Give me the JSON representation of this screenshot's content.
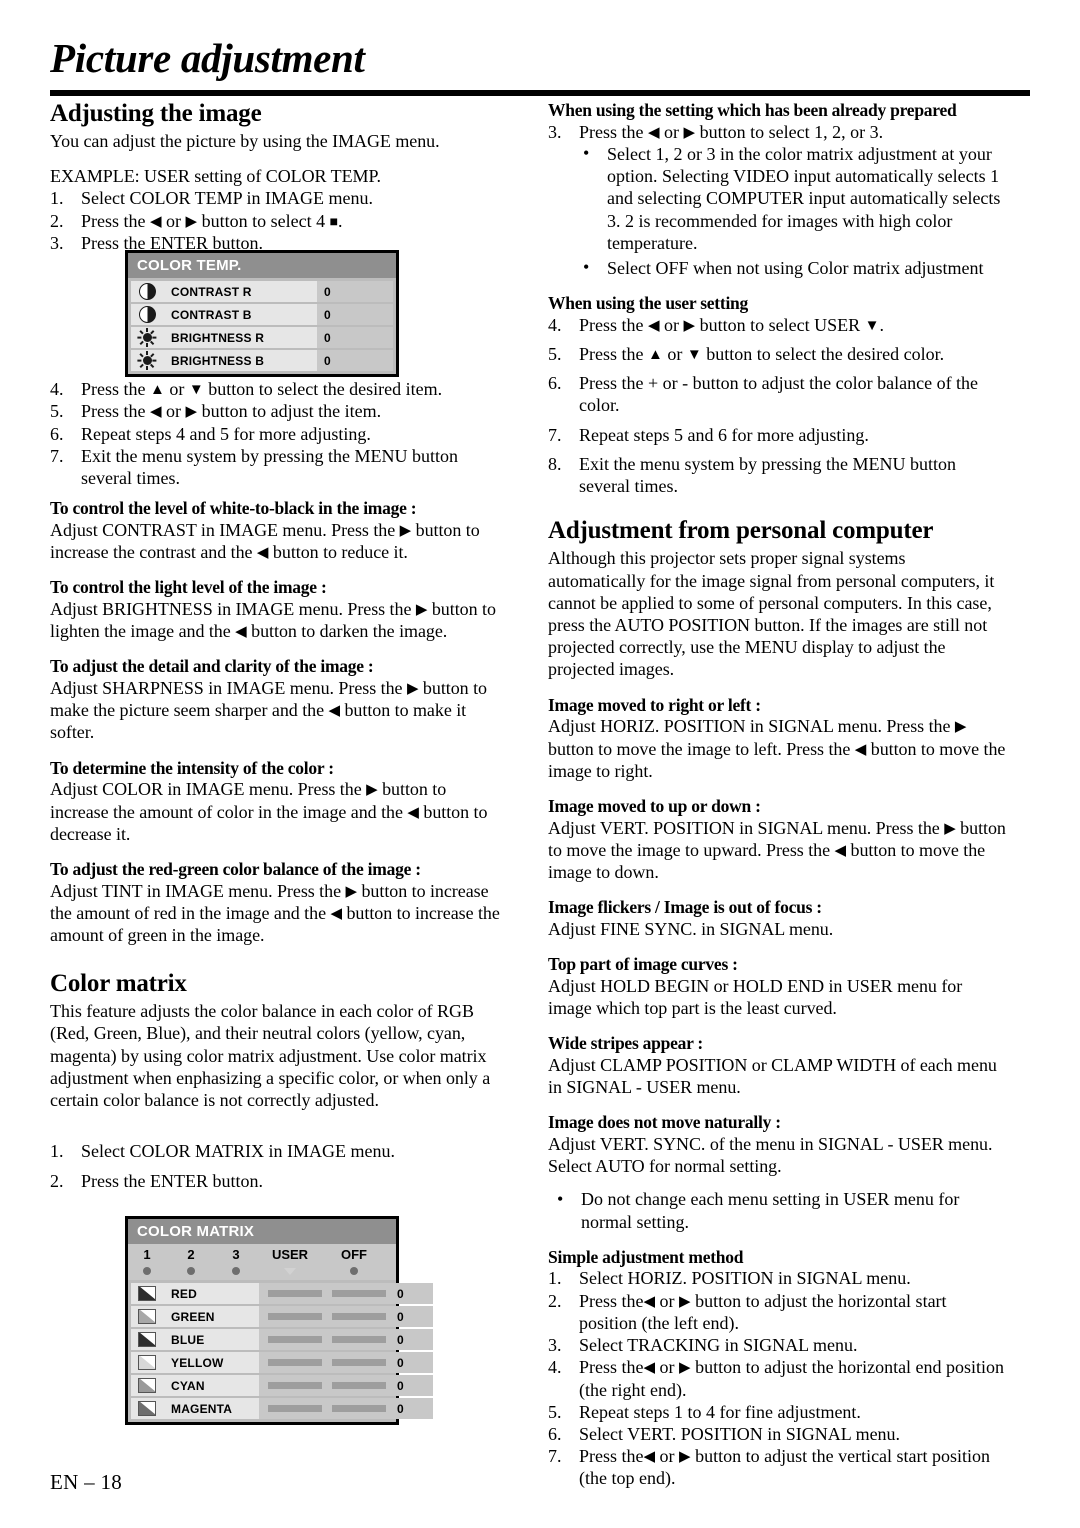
{
  "page": {
    "title": "Picture adjustment",
    "footer": "EN – 18"
  },
  "left_column": {
    "section1_heading": "Adjusting the image",
    "section1_intro": "You can adjust the picture by using the IMAGE menu.",
    "example_label": "EXAMPLE: USER setting of COLOR TEMP.",
    "steps_1_3": [
      {
        "num": "1.",
        "text": "Select COLOR TEMP in IMAGE menu."
      },
      {
        "num": "2.",
        "pre": "Press the ",
        "a1": "◀",
        "mid": " or ",
        "a2": "▶",
        "post": " button to select 4 ",
        "sq": "■",
        "tail": "."
      },
      {
        "num": "3.",
        "text": "Press the ENTER button."
      }
    ],
    "steps_4_7": [
      {
        "num": "4.",
        "pre": "Press the ",
        "a1": "▲",
        "mid": " or ",
        "a2": "▼",
        "post": " button to select the desired item."
      },
      {
        "num": "5.",
        "pre": "Press the ",
        "a1": "◀",
        "mid": " or ",
        "a2": "▶",
        "post": " button to adjust the item."
      },
      {
        "num": "6.",
        "text": "Repeat steps 4 and 5 for more adjusting."
      },
      {
        "num": "7.",
        "text": "Exit the menu system by pressing the MENU button several times."
      }
    ],
    "tips": [
      {
        "heading": "To control the level of white-to-black in the image :",
        "p1": "Adjust CONTRAST in IMAGE menu.  Press the ",
        "a1": "▶",
        "p2": " button to increase the contrast and the ",
        "a2": "◀",
        "p3": " button to reduce it."
      },
      {
        "heading": "To control the light level of the image :",
        "p1": "Adjust BRIGHTNESS in IMAGE menu.  Press the ",
        "a1": "▶",
        "p2": " button to lighten the image and the ",
        "a2": "◀",
        "p3": " button to darken the image."
      },
      {
        "heading": "To adjust the detail and clarity of the image :",
        "p1": "Adjust SHARPNESS in IMAGE menu.  Press the ",
        "a1": "▶",
        "p2": " button to make the picture seem sharper and the ",
        "a2": "◀",
        "p3": " button to make it softer."
      },
      {
        "heading": "To determine the intensity of the color :",
        "p1": "Adjust COLOR in IMAGE menu.  Press the ",
        "a1": "▶",
        "p2": " button to increase the amount of color in the image and the ",
        "a2": "◀",
        "p3": " button to decrease it."
      },
      {
        "heading": "To adjust the red-green color balance of the image :",
        "p1": "Adjust TINT in IMAGE menu.  Press the ",
        "a1": "▶",
        "p2": " button to increase the amount of red in the image and the ",
        "a2": "◀",
        "p3": " button to increase the amount of green in the image."
      }
    ],
    "section2_heading": "Color matrix",
    "section2_body": "This feature adjusts the color balance in each color of RGB (Red, Green, Blue), and their neutral colors (yellow, cyan, magenta) by using color matrix adjustment. Use color matrix adjustment when enphasizing a specific color, or when only a certain color balance is not correctly adjusted.",
    "section2_steps": [
      {
        "num": "1.",
        "text": "Select COLOR MATRIX in IMAGE menu."
      },
      {
        "num": "2.",
        "text": "Press the ENTER button."
      }
    ]
  },
  "right_column": {
    "prepared_heading": "When using the setting which has been already prepared",
    "prepared_step": {
      "num": "3.",
      "pre": "Press the ",
      "a1": "◀",
      "mid": " or ",
      "a2": "▶",
      "post": " button to select 1, 2, or 3."
    },
    "prepared_bullets": [
      "Select 1, 2 or 3 in the color matrix adjustment at your option. Selecting VIDEO input automatically selects 1 and selecting COMPUTER input automatically selects 3. 2 is recommended for images with high color temperature.",
      "Select OFF when not using Color matrix adjustment"
    ],
    "user_heading": "When using the user setting",
    "user_steps": [
      {
        "num": "4.",
        "pre": "Press the ",
        "a1": "◀",
        "mid": " or ",
        "a2": "▶",
        "post": " button to select USER ",
        "a3": "▼",
        "tail": "."
      },
      {
        "num": "5.",
        "pre": "Press the ",
        "a1": "▲",
        "mid": " or ",
        "a2": "▼",
        "post": " button to select the desired color."
      },
      {
        "num": "6.",
        "text": "Press the + or - button to adjust the color balance of the color."
      },
      {
        "num": "7.",
        "text": "Repeat steps 5 and 6 for more adjusting."
      },
      {
        "num": "8.",
        "text": "Exit the menu system by pressing the MENU button several times."
      }
    ],
    "pc_heading": "Adjustment from personal computer",
    "pc_body": "Although this projector sets proper signal systems automatically for the image signal from personal computers, it cannot be applied to some of personal computers.  In this case, press the AUTO POSITION button.  If the images are still not projected correctly, use the MENU display to adjust the projected images.",
    "pc_tips": [
      {
        "heading": "Image moved to right or left :",
        "p1": "Adjust HORIZ. POSITION in SIGNAL menu.  Press the ",
        "a1": "▶",
        "p2": " button to move the image to left.  Press the ",
        "a2": "◀",
        "p3": " button to move the image to right."
      },
      {
        "heading": "Image moved to up or down :",
        "p1": "Adjust VERT. POSITION in SIGNAL menu.  Press the ",
        "a1": "▶",
        "p2": " button to move the image to upward.  Press the ",
        "a2": "◀",
        "p3": " button to move the image to down."
      },
      {
        "heading": "Image flickers / Image is out of focus :",
        "p1": "Adjust FINE SYNC. in SIGNAL menu.",
        "a1": "",
        "p2": "",
        "a2": "",
        "p3": ""
      },
      {
        "heading": "Top part of image curves :",
        "p1": "Adjust HOLD BEGIN or HOLD END in USER menu for image which top part is the least curved.",
        "a1": "",
        "p2": "",
        "a2": "",
        "p3": ""
      },
      {
        "heading": "Wide stripes appear :",
        "p1": "Adjust CLAMP POSITION or CLAMP WIDTH of each menu in SIGNAL - USER menu.",
        "a1": "",
        "p2": "",
        "a2": "",
        "p3": ""
      },
      {
        "heading": "Image does not move naturally :",
        "p1": "Adjust VERT. SYNC. of the menu in SIGNAL - USER menu.  Select AUTO for normal setting.",
        "a1": "",
        "p2": "",
        "a2": "",
        "p3": ""
      }
    ],
    "pc_bullet": "Do not change each menu setting in USER menu for normal setting.",
    "simple_heading": "Simple adjustment method",
    "simple_steps": [
      {
        "num": "1.",
        "text": "Select HORIZ. POSITION in SIGNAL menu."
      },
      {
        "num": "2.",
        "pre": "Press the",
        "a1": "◀",
        "mid": " or ",
        "a2": "▶",
        "post": " button to adjust the horizontal start position (the left end)."
      },
      {
        "num": "3.",
        "text": "Select TRACKING in SIGNAL menu."
      },
      {
        "num": "4.",
        "pre": "Press the",
        "a1": "◀",
        "mid": " or ",
        "a2": "▶",
        "post": " button to adjust the horizontal end position (the right end)."
      },
      {
        "num": "5.",
        "text": "Repeat steps 1 to 4 for fine adjustment."
      },
      {
        "num": "6.",
        "text": "Select VERT. POSITION in SIGNAL menu."
      },
      {
        "num": "7.",
        "pre": "Press the",
        "a1": "◀",
        "mid": " or ",
        "a2": "▶",
        "post": " button to adjust the vertical start position (the top end)."
      }
    ]
  },
  "osd_color_temp": {
    "title": "COLOR TEMP.",
    "rows": [
      {
        "icon": "contrast-icon",
        "label": "CONTRAST R",
        "value": "0"
      },
      {
        "icon": "contrast-icon",
        "label": "CONTRAST B",
        "value": "0"
      },
      {
        "icon": "brightness-icon",
        "label": "BRIGHTNESS R",
        "value": "0"
      },
      {
        "icon": "brightness-icon",
        "label": "BRIGHTNESS B",
        "value": "0"
      }
    ]
  },
  "osd_color_matrix": {
    "title": "COLOR MATRIX",
    "columns": [
      "1",
      "2",
      "3",
      "USER",
      "OFF"
    ],
    "markers": [
      "dot",
      "dot",
      "dot",
      "triangle",
      "dot"
    ],
    "rows": [
      {
        "icon": "swatch-red-icon",
        "label": "RED",
        "value": "0",
        "swatch": "#2e2e2e"
      },
      {
        "icon": "swatch-green-icon",
        "label": "GREEN",
        "value": "0",
        "swatch": "#a8a8a8"
      },
      {
        "icon": "swatch-blue-icon",
        "label": "BLUE",
        "value": "0",
        "swatch": "#2e2e2e"
      },
      {
        "icon": "swatch-yellow-icon",
        "label": "YELLOW",
        "value": "0",
        "swatch": "#d8d8d8"
      },
      {
        "icon": "swatch-cyan-icon",
        "label": "CYAN",
        "value": "0",
        "swatch": "#9a9a9a"
      },
      {
        "icon": "swatch-magenta-icon",
        "label": "MAGENTA",
        "value": "0",
        "swatch": "#6e6e6e"
      }
    ]
  }
}
